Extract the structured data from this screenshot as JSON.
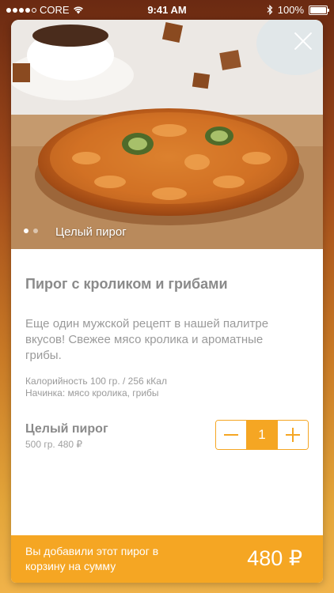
{
  "status_bar": {
    "carrier": "CORE",
    "time": "9:41 AM",
    "battery": "100%"
  },
  "photo": {
    "caption": "Целый пирог",
    "pager_count": 2,
    "pager_active_index": 0
  },
  "product": {
    "title": "Пирог с кроликом и грибами",
    "description": "Еще один мужской рецепт в нашей палитре вкусов! Свежее мясо кролика и ароматные грибы.",
    "calories": "Калорийность 100 гр. / 256 кКал",
    "filling": "Начинка: мясо кролика, грибы"
  },
  "option": {
    "name": "Целый пирог",
    "detail": "500 гр. 480 ₽",
    "quantity": "1"
  },
  "cart_bar": {
    "message": "Вы добавили этот пирог в корзину на сумму",
    "total": "480 ₽"
  },
  "colors": {
    "accent": "#f5a623",
    "text_primary": "#8a8a8a",
    "text_secondary": "#9a9a9a"
  },
  "icons": {
    "close": "close-icon",
    "minus": "minus-icon",
    "plus": "plus-icon",
    "wifi": "wifi-icon",
    "bluetooth": "bluetooth-icon",
    "battery": "battery-icon"
  }
}
